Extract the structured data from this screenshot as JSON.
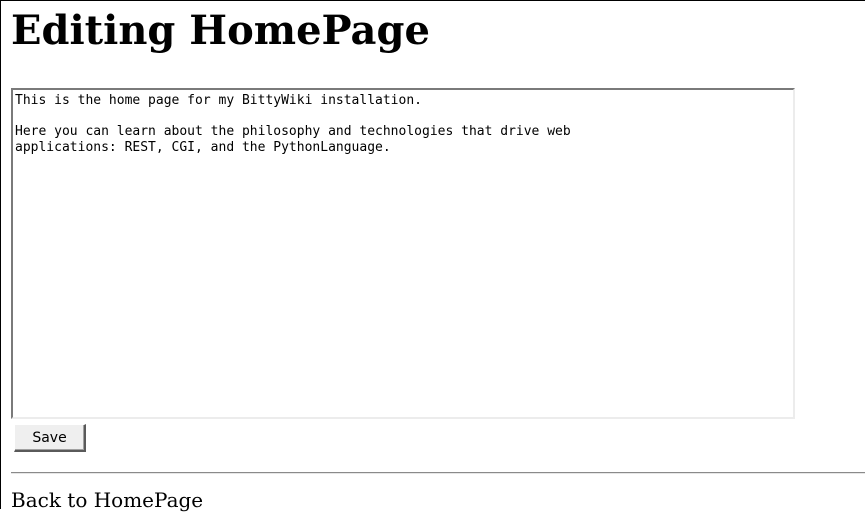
{
  "page": {
    "title": "Editing HomePage"
  },
  "editor": {
    "content": "This is the home page for my BittyWiki installation.\n\nHere you can learn about the philosophy and technologies that drive web\napplications: REST, CGI, and the PythonLanguage."
  },
  "form": {
    "save_label": "Save"
  },
  "footer": {
    "back_link_label": "Back to HomePage"
  }
}
